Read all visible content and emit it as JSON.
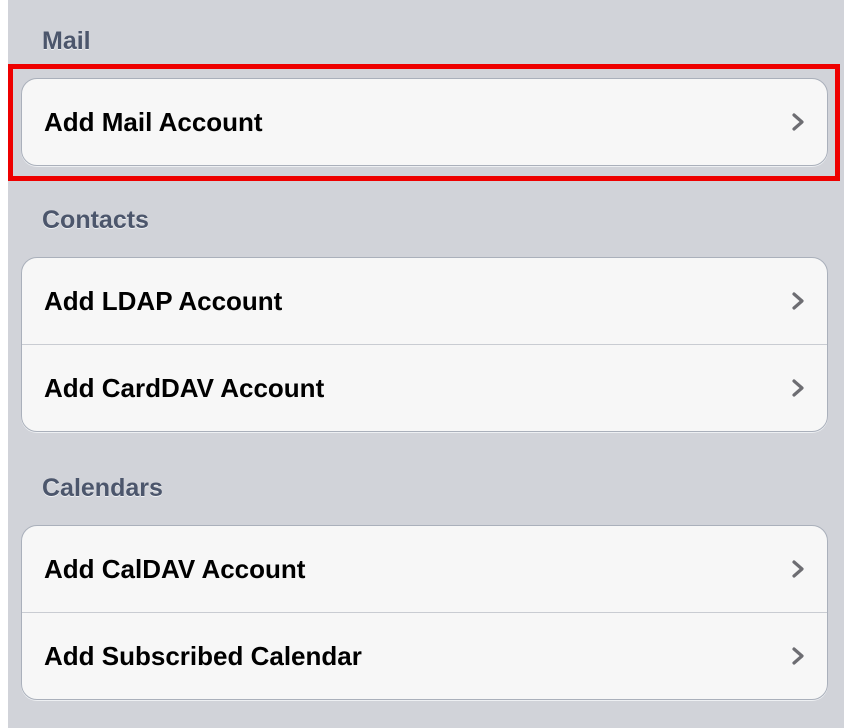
{
  "sections": [
    {
      "header": "Mail",
      "items": [
        {
          "label": "Add Mail Account",
          "icon": "chevron-right-icon"
        }
      ]
    },
    {
      "header": "Contacts",
      "items": [
        {
          "label": "Add LDAP Account",
          "icon": "chevron-right-icon"
        },
        {
          "label": "Add CardDAV Account",
          "icon": "chevron-right-icon"
        }
      ]
    },
    {
      "header": "Calendars",
      "items": [
        {
          "label": "Add CalDAV Account",
          "icon": "chevron-right-icon"
        },
        {
          "label": "Add Subscribed Calendar",
          "icon": "chevron-right-icon"
        }
      ]
    }
  ],
  "colors": {
    "background": "#d1d3d9",
    "section_header_text": "#4c566c",
    "cell_background": "#f7f7f7",
    "cell_text": "#000000",
    "chevron": "#6d6d72",
    "highlight_outline": "#ee0000"
  },
  "highlight": {
    "target": "Add Mail Account"
  }
}
